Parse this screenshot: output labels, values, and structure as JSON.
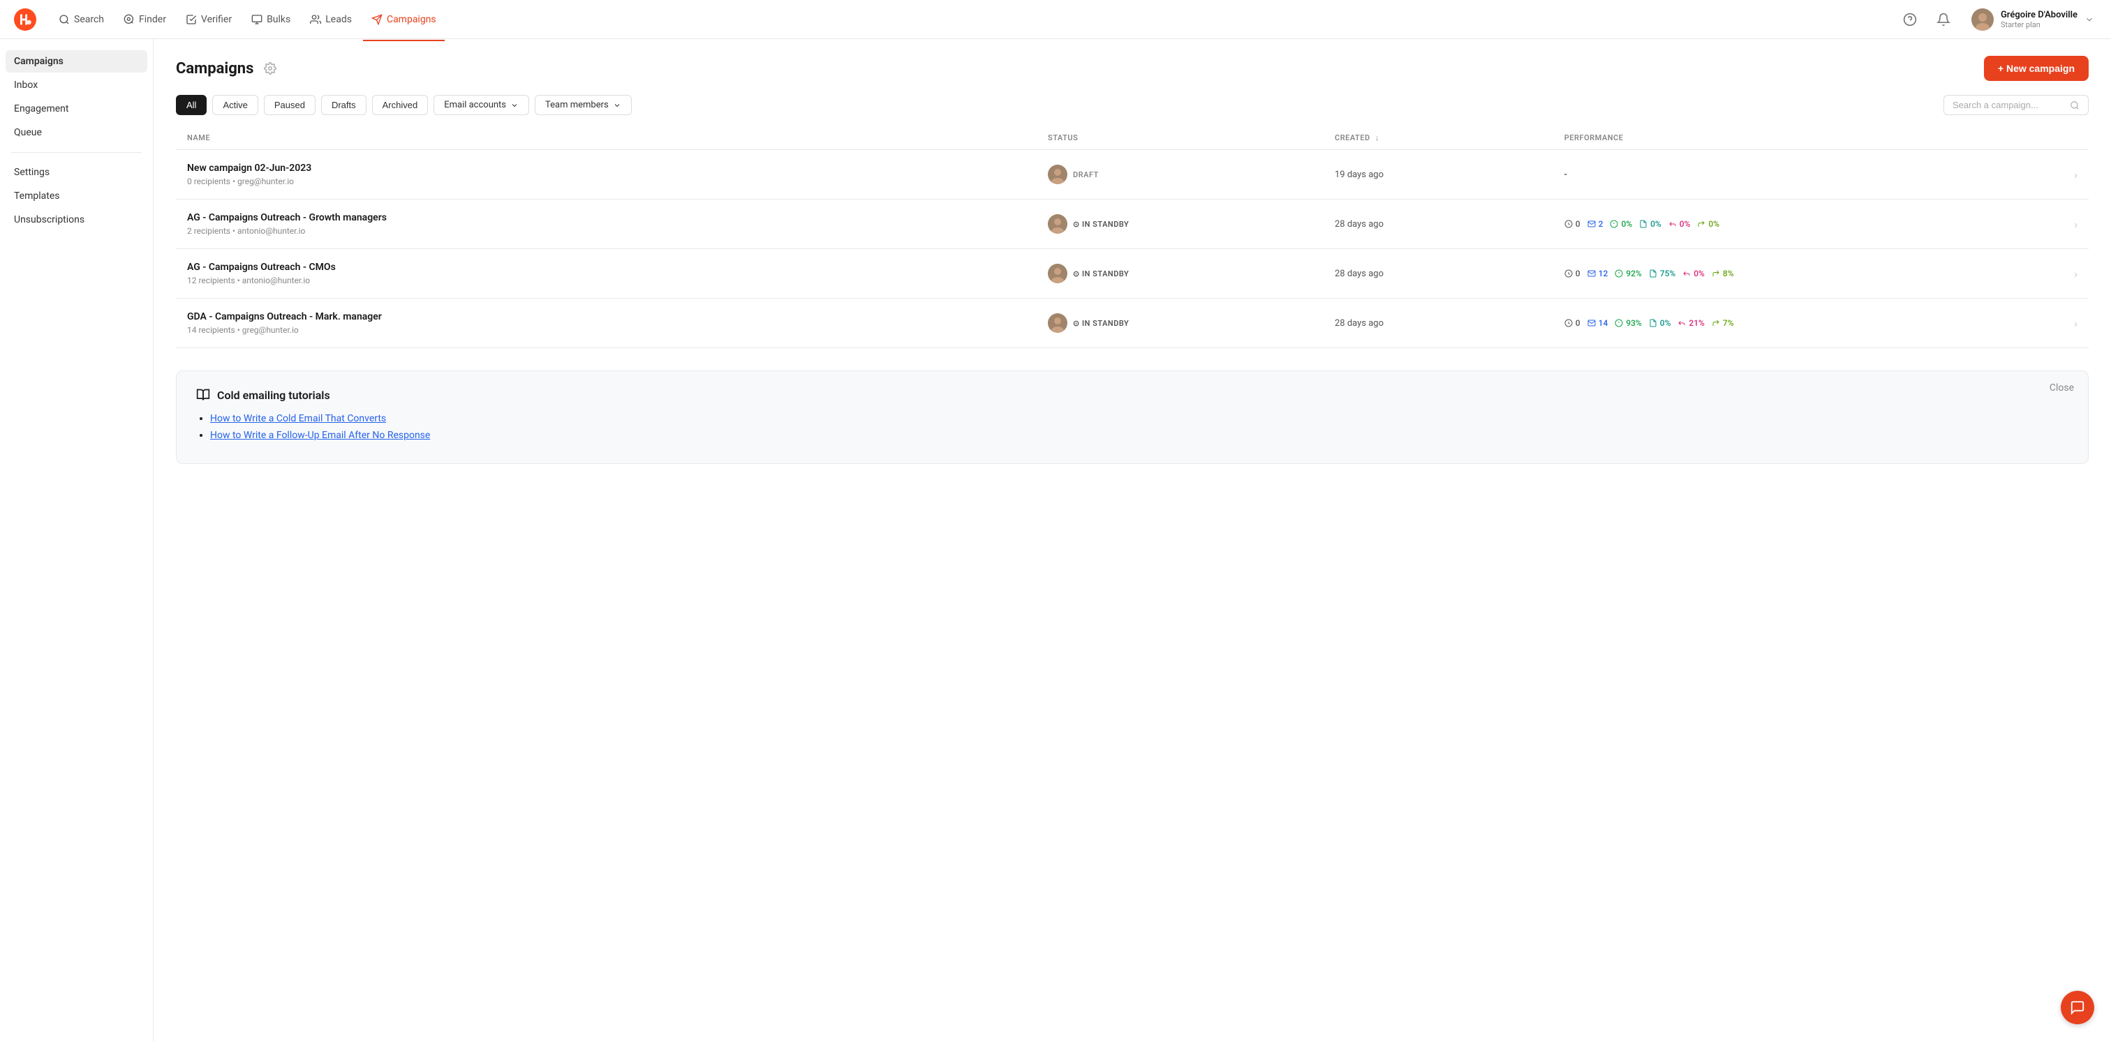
{
  "app": {
    "logo_alt": "Hunter logo"
  },
  "topnav": {
    "items": [
      {
        "id": "search",
        "label": "Search",
        "icon": "search-icon",
        "active": false
      },
      {
        "id": "finder",
        "label": "Finder",
        "icon": "finder-icon",
        "active": false
      },
      {
        "id": "verifier",
        "label": "Verifier",
        "icon": "verifier-icon",
        "active": false
      },
      {
        "id": "bulks",
        "label": "Bulks",
        "icon": "bulks-icon",
        "active": false
      },
      {
        "id": "leads",
        "label": "Leads",
        "icon": "leads-icon",
        "active": false
      },
      {
        "id": "campaigns",
        "label": "Campaigns",
        "icon": "campaigns-icon",
        "active": true
      }
    ],
    "help_label": "?",
    "user": {
      "name": "Grégoire D'Aboville",
      "plan": "Starter plan"
    }
  },
  "sidebar": {
    "items_top": [
      {
        "id": "campaigns",
        "label": "Campaigns",
        "active": true
      },
      {
        "id": "inbox",
        "label": "Inbox",
        "active": false
      },
      {
        "id": "engagement",
        "label": "Engagement",
        "active": false
      },
      {
        "id": "queue",
        "label": "Queue",
        "active": false
      }
    ],
    "items_bottom": [
      {
        "id": "settings",
        "label": "Settings",
        "active": false
      },
      {
        "id": "templates",
        "label": "Templates",
        "active": false
      },
      {
        "id": "unsubscriptions",
        "label": "Unsubscriptions",
        "active": false
      }
    ]
  },
  "page": {
    "title": "Campaigns",
    "new_campaign_label": "+ New campaign"
  },
  "filters": {
    "tabs": [
      {
        "id": "all",
        "label": "All",
        "active": true
      },
      {
        "id": "active",
        "label": "Active",
        "active": false
      },
      {
        "id": "paused",
        "label": "Paused",
        "active": false
      },
      {
        "id": "drafts",
        "label": "Drafts",
        "active": false
      },
      {
        "id": "archived",
        "label": "Archived",
        "active": false
      }
    ],
    "email_accounts_label": "Email accounts",
    "team_members_label": "Team members",
    "search_placeholder": "Search a campaign..."
  },
  "table": {
    "columns": [
      {
        "id": "name",
        "label": "NAME"
      },
      {
        "id": "status",
        "label": "STATUS"
      },
      {
        "id": "created",
        "label": "CREATED",
        "sortable": true
      },
      {
        "id": "performance",
        "label": "PERFORMANCE"
      }
    ],
    "rows": [
      {
        "id": 1,
        "name": "New campaign 02-Jun-2023",
        "meta": "0 recipients • greg@hunter.io",
        "status": "DRAFT",
        "status_type": "draft",
        "created": "19 days ago",
        "performance": null
      },
      {
        "id": 2,
        "name": "AG - Campaigns Outreach - Growth managers",
        "meta": "2 recipients • antonio@hunter.io",
        "status": "IN STANDBY",
        "status_type": "standby",
        "created": "28 days ago",
        "performance": {
          "queue": 0,
          "sent": 2,
          "open_pct": "0%",
          "click_pct": "0%",
          "reply_pct": "0%",
          "bounce_pct": "0%"
        }
      },
      {
        "id": 3,
        "name": "AG - Campaigns Outreach - CMOs",
        "meta": "12 recipients • antonio@hunter.io",
        "status": "IN STANDBY",
        "status_type": "standby",
        "created": "28 days ago",
        "performance": {
          "queue": 0,
          "sent": 12,
          "open_pct": "92%",
          "click_pct": "75%",
          "reply_pct": "0%",
          "bounce_pct": "8%"
        }
      },
      {
        "id": 4,
        "name": "GDA - Campaigns Outreach - Mark. manager",
        "meta": "14 recipients • greg@hunter.io",
        "status": "IN STANDBY",
        "status_type": "standby",
        "created": "28 days ago",
        "performance": {
          "queue": 0,
          "sent": 14,
          "open_pct": "93%",
          "click_pct": "0%",
          "reply_pct": "21%",
          "bounce_pct": "7%"
        }
      }
    ]
  },
  "tutorial": {
    "title": "Cold emailing tutorials",
    "close_label": "Close",
    "links": [
      {
        "id": 1,
        "label": "How to Write a Cold Email That Converts"
      },
      {
        "id": 2,
        "label": "How to Write a Follow-Up Email After No Response"
      }
    ]
  }
}
